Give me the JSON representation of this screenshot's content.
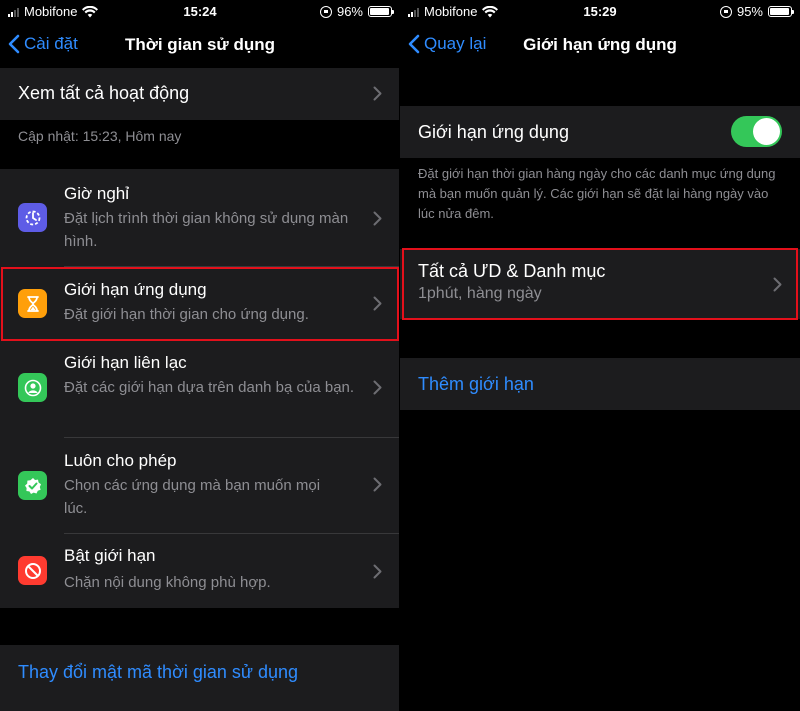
{
  "left": {
    "status": {
      "carrier": "Mobifone",
      "time": "15:24",
      "battery": "96%",
      "battery_level": 0.96
    },
    "nav": {
      "back_label": "Cài đặt",
      "title": "Thời gian sử dụng"
    },
    "see_all": "Xem tất cả hoạt động",
    "updated": "Cập nhật: 15:23, Hôm nay",
    "items": [
      {
        "label": "Giờ nghỉ",
        "sub": "Đặt lịch trình thời gian không sử dụng màn hình.",
        "icon": "downtime-icon",
        "color": "#5e5ce6"
      },
      {
        "label": "Giới hạn ứng dụng",
        "sub": "Đặt giới hạn thời gian cho ứng dụng.",
        "icon": "hourglass-icon",
        "color": "#ff9f0a"
      },
      {
        "label": "Giới hạn liên lạc",
        "sub": "Đặt các giới hạn dựa trên danh bạ của bạn.",
        "icon": "contact-icon",
        "color": "#34c759"
      },
      {
        "label": "Luôn cho phép",
        "sub": "Chọn các ứng dụng mà bạn muốn mọi lúc.",
        "icon": "checkmark-badge-icon",
        "color": "#34c759"
      },
      {
        "label": "Bật giới hạn",
        "sub": "Chặn nội dung không phù hợp.",
        "icon": "restriction-icon",
        "color": "#ff3b30"
      }
    ],
    "change_passcode": "Thay đổi mật mã thời gian sử dụng"
  },
  "right": {
    "status": {
      "carrier": "Mobifone",
      "time": "15:29",
      "battery": "95%",
      "battery_level": 0.95
    },
    "nav": {
      "back_label": "Quay lại",
      "title": "Giới hạn ứng dụng"
    },
    "toggle_label": "Giới hạn ứng dụng",
    "toggle_on": true,
    "description": "Đặt giới hạn thời gian hàng ngày cho các danh mục ứng dụng mà bạn muốn quản lý. Các giới hạn sẽ đặt lại hàng ngày vào lúc nửa đêm.",
    "limit_item": {
      "label": "Tất cả ƯD & Danh mục",
      "sub": "1phút, hàng ngày"
    },
    "add_limit": "Thêm giới hạn"
  },
  "colors": {
    "accent": "#2f8cff",
    "highlight": "#e3101b",
    "toggle_on": "#34c759"
  }
}
